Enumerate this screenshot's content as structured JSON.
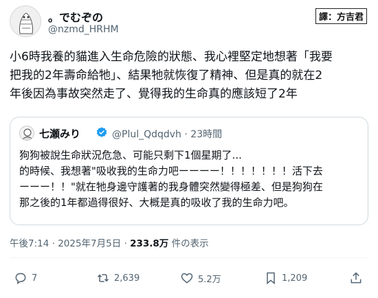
{
  "tweet": {
    "display_name": "。でむぞの",
    "handle": "@nzmd_HRHM",
    "watermark": "譯：方吉君",
    "lines": [
      "小6時我養的貓進入生命危險的狀態、我心裡堅定地想著「我要",
      "把我的2年壽命給牠」、結果牠就恢復了精神、但是真的就在2",
      "年後因為事故突然走了、覺得我的生命真的應該短了2年"
    ],
    "time": "午後7:14 · 2025年7月5日 · ",
    "views_count": "233.8万",
    "views_suffix": " 件の表示"
  },
  "quote": {
    "display_name": "七瀬みり",
    "handle_time": "@Plul_Qdqdvh · 23時間",
    "lines": [
      "狗狗被說生命狀況危急、可能只剩下1個星期了...",
      "的時候、我想著\"吸收我的生命力吧ーーーー！！！！！！！活下去",
      "ーーー！！\"就在牠身邊守護著的我身體突然變得極差、但是狗狗在",
      "那之後的1年都過得很好、大概是真的吸收了我的生命力吧。"
    ]
  },
  "actions": {
    "reply_count": "7",
    "retweet_count": "2,639",
    "like_count": "5.2万",
    "views_count": "1,209"
  },
  "icons": [
    "reply-icon",
    "retweet-icon",
    "like-icon",
    "views-icon",
    "share-icon",
    "verified-badge-icon"
  ],
  "colors": {
    "verified": "#1d9bf0",
    "secondary_text": "#536471",
    "border": "#cfd9de"
  }
}
